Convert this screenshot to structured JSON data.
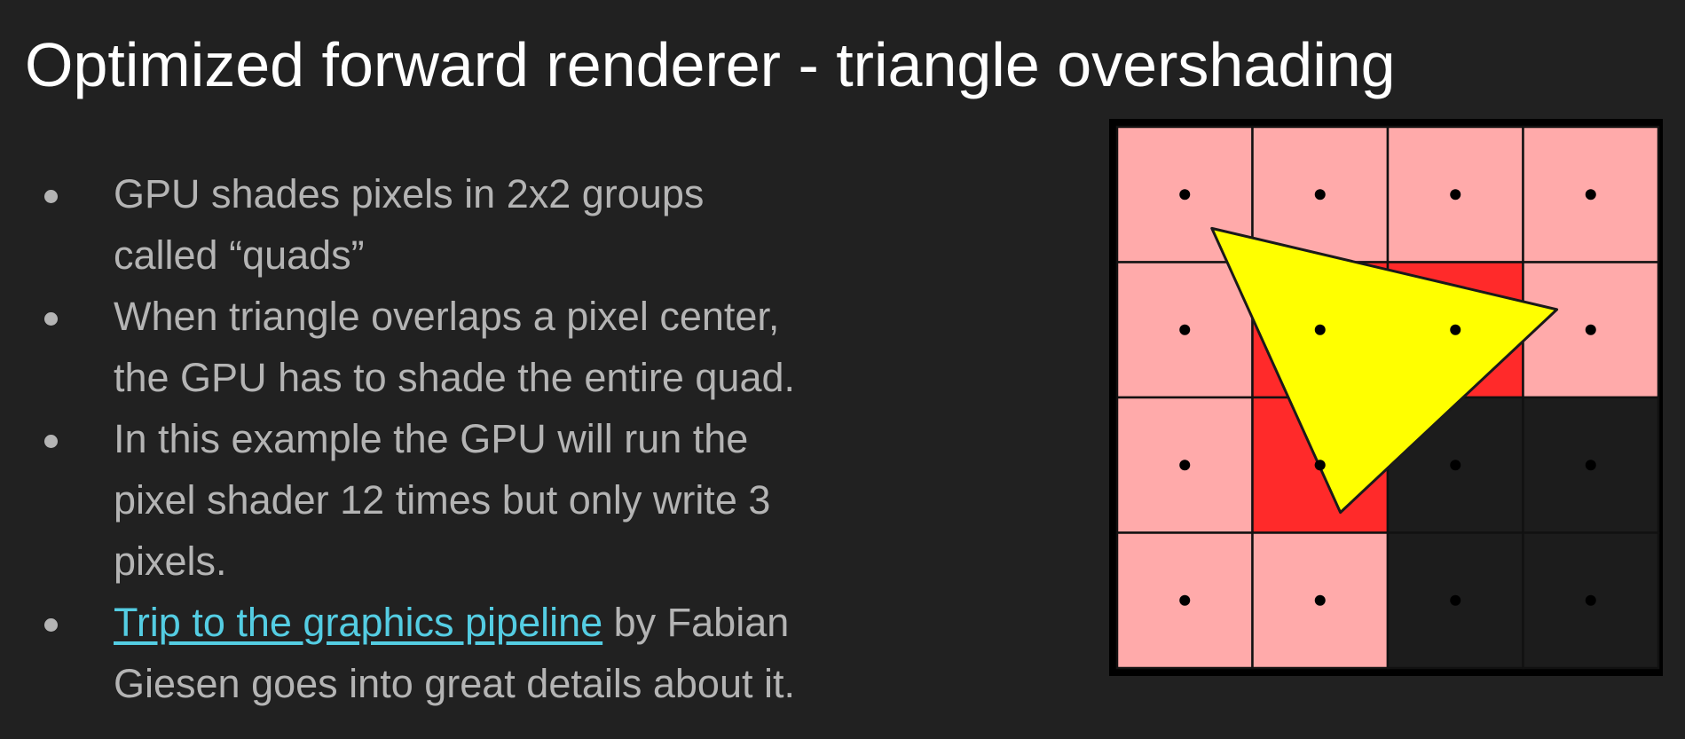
{
  "slide": {
    "title": "Optimized forward renderer - triangle overshading",
    "bullets": [
      {
        "lines": [
          "GPU shades pixels in 2x2 groups",
          "called “quads”"
        ]
      },
      {
        "lines": [
          "When triangle overlaps a pixel center,",
          "the GPU has to shade the entire quad."
        ]
      },
      {
        "lines": [
          "In this example the GPU will run the",
          "pixel shader 12 times but only write 3",
          "pixels."
        ]
      },
      {
        "link_text": "Trip to the graphics pipeline",
        "after_link": " by Fabian",
        "line2": "Giesen goes into great details about it."
      }
    ]
  },
  "diagram": {
    "colors": {
      "background": "#212121",
      "text_title": "#ffffff",
      "text_body": "#b4b4b4",
      "link": "#54cde3",
      "frame": "#000000",
      "grid_line": "#111111",
      "pink_cell": "#ffaaaa",
      "red_cell": "#ff2a2a",
      "dark_cell": "#1c1c1c",
      "triangle_fill": "#ffff00",
      "triangle_stroke": "#1a1a1a",
      "sample_dot": "#000000"
    },
    "grid": {
      "columns": 4,
      "rows": 4,
      "cells": [
        [
          "pink",
          "pink",
          "pink",
          "pink"
        ],
        [
          "pink",
          "red",
          "red",
          "pink"
        ],
        [
          "pink",
          "red",
          "dark",
          "dark"
        ],
        [
          "pink",
          "pink",
          "dark",
          "dark"
        ]
      ]
    },
    "triangle": {
      "vertices_in_cell_units": [
        [
          0.7,
          0.75
        ],
        [
          3.25,
          1.35
        ],
        [
          1.65,
          2.85
        ]
      ]
    }
  }
}
